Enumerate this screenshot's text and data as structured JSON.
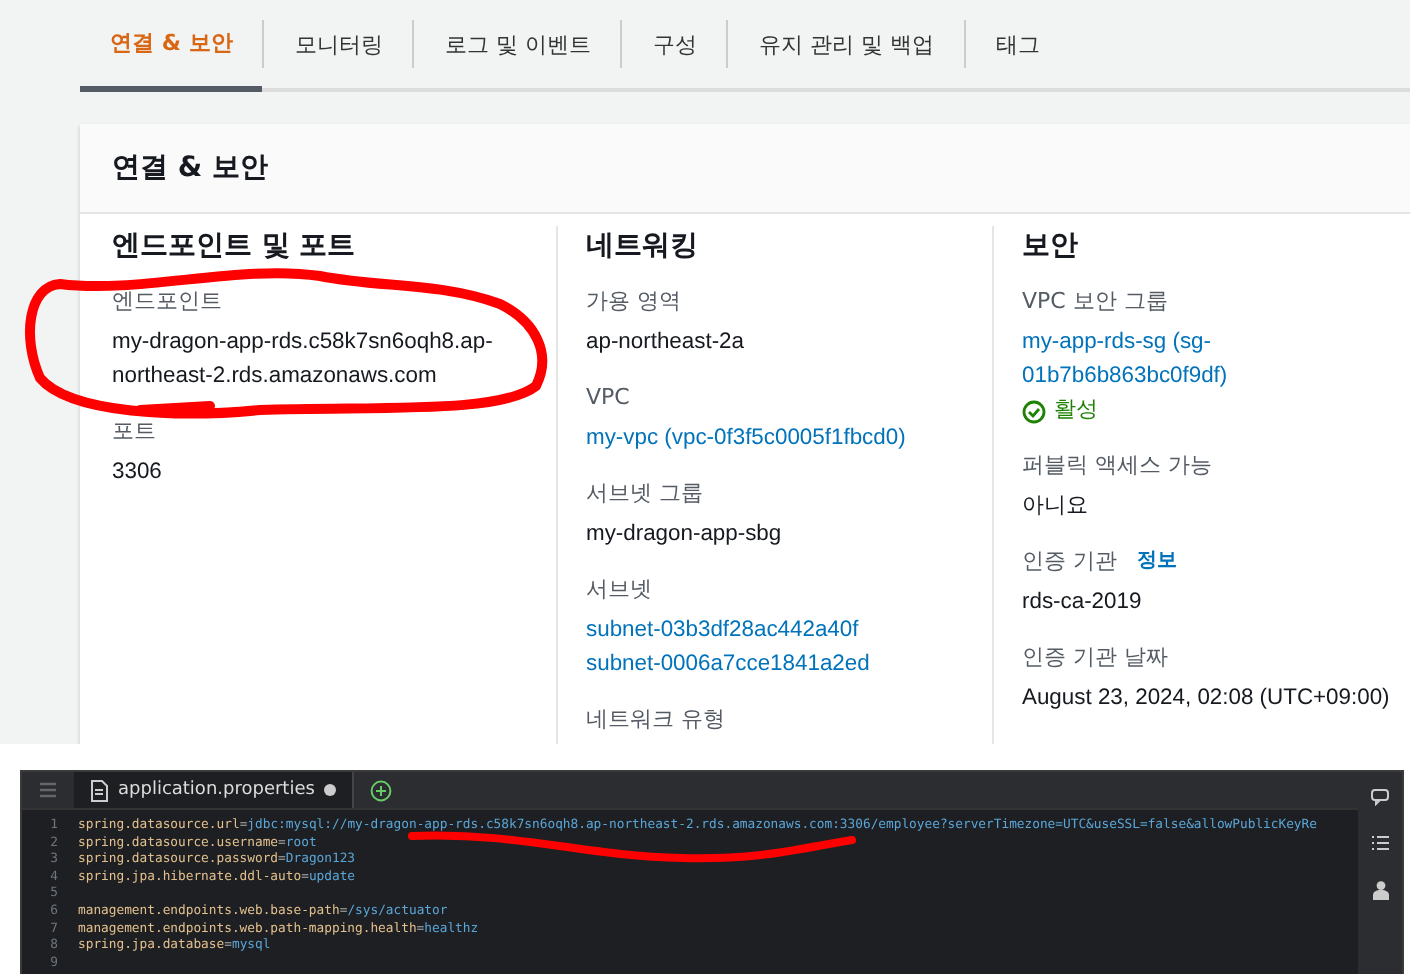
{
  "tabs": [
    {
      "label": "연결 & 보안",
      "selected": true
    },
    {
      "label": "모니터링",
      "selected": false
    },
    {
      "label": "로그 및 이벤트",
      "selected": false
    },
    {
      "label": "구성",
      "selected": false
    },
    {
      "label": "유지 관리 및 백업",
      "selected": false
    },
    {
      "label": "태그",
      "selected": false
    }
  ],
  "section": {
    "title": "연결 & 보안",
    "columns": [
      {
        "heading": "엔드포인트 및 포트",
        "fields": [
          {
            "label": "엔드포인트",
            "values": [
              {
                "kind": "text",
                "text": "my-dragon-app-rds.c58k7sn6oqh8.ap-northeast-2.rds.amazonaws.com"
              }
            ]
          },
          {
            "label": "포트",
            "values": [
              {
                "kind": "text",
                "text": "3306"
              }
            ]
          }
        ]
      },
      {
        "heading": "네트워킹",
        "fields": [
          {
            "label": "가용 영역",
            "values": [
              {
                "kind": "text",
                "text": "ap-northeast-2a"
              }
            ]
          },
          {
            "label": "VPC",
            "values": [
              {
                "kind": "link",
                "text": "my-vpc (vpc-0f3f5c0005f1fbcd0)"
              }
            ]
          },
          {
            "label": "서브넷 그룹",
            "values": [
              {
                "kind": "text",
                "text": "my-dragon-app-sbg"
              }
            ]
          },
          {
            "label": "서브넷",
            "values": [
              {
                "kind": "link",
                "text": "subnet-03b3df28ac442a40f"
              },
              {
                "kind": "link",
                "text": "subnet-0006a7cce1841a2ed"
              }
            ]
          },
          {
            "label": "네트워크 유형"
          }
        ]
      },
      {
        "heading": "보안",
        "fields": [
          {
            "label": "VPC 보안 그룹",
            "values": [
              {
                "kind": "link",
                "text": "my-app-rds-sg (sg-01b7b6b863bc0f9df)"
              },
              {
                "kind": "status",
                "text": "활성"
              }
            ]
          },
          {
            "label": "퍼블릭 액세스 가능",
            "values": [
              {
                "kind": "text",
                "text": "아니요"
              }
            ]
          },
          {
            "label": "인증 기관",
            "info": "정보",
            "values": [
              {
                "kind": "text",
                "text": "rds-ca-2019"
              }
            ]
          },
          {
            "label": "인증 기관 날짜",
            "values": [
              {
                "kind": "text",
                "text": "August 23, 2024, 02:08 (UTC+09:00)"
              }
            ]
          }
        ]
      }
    ]
  },
  "editor": {
    "tab": {
      "label": "application.properties",
      "modified": true
    },
    "lines": [
      {
        "number": "1",
        "key": "spring.datasource.url",
        "operator": "=",
        "value": "jdbc:mysql://my-dragon-app-rds.c58k7sn6oqh8.ap-northeast-2.rds.amazonaws.com:3306/employee?serverTimezone=UTC&useSSL=false&allowPublicKeyRe"
      },
      {
        "number": "2",
        "key": "spring.datasource.username",
        "operator": "=",
        "value": "root"
      },
      {
        "number": "3",
        "key": "spring.datasource.password",
        "operator": "=",
        "value": "Dragon123"
      },
      {
        "number": "4",
        "key": "spring.jpa.hibernate.ddl-auto",
        "operator": "=",
        "value": "update"
      },
      {
        "number": "5"
      },
      {
        "number": "6",
        "key": "management.endpoints.web.base-path",
        "operator": "=",
        "value": "/sys/actuator"
      },
      {
        "number": "7",
        "key": "management.endpoints.web.path-mapping.health",
        "operator": "=",
        "value": "healthz"
      },
      {
        "number": "8",
        "key": "spring.jpa.database",
        "operator": "=",
        "value": "mysql"
      },
      {
        "number": "9"
      }
    ]
  }
}
